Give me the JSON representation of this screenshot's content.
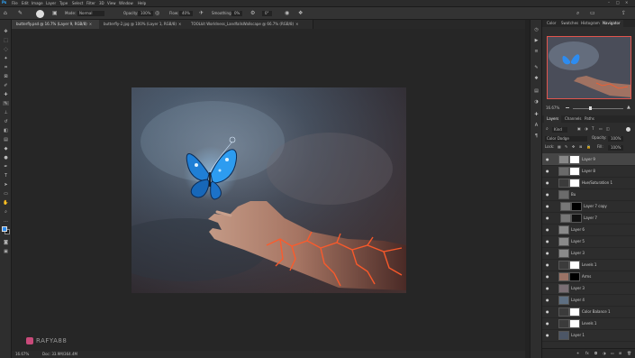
{
  "colors": {
    "accent": "#2d8cf0",
    "selection_red": "#e2554e"
  },
  "menubar": {
    "app_icon": "Ps",
    "items": [
      "File",
      "Edit",
      "Image",
      "Layer",
      "Type",
      "Select",
      "Filter",
      "3D",
      "View",
      "Window",
      "Help"
    ]
  },
  "options": {
    "mode_label": "Mode:",
    "mode_value": "Normal",
    "opacity_label": "Opacity:",
    "opacity_value": "100%",
    "flow_label": "Flow:",
    "flow_value": "40%",
    "smoothing_label": "Smoothing:",
    "smoothing_value": "0%",
    "angle_value": "0°"
  },
  "tabs": [
    {
      "label": "butterfly.psd @ 16.7% (Layer 9, RGB/8)",
      "close": "×"
    },
    {
      "label": "butterfly-2.jpg @ 100% (Layer 1, RGB/8)",
      "close": "×"
    },
    {
      "label": "TOOLkit Worldness_LandfallsWallscape @ 66.7% (RGB/8)",
      "close": "×"
    }
  ],
  "status": {
    "zoom": "16.67%",
    "doc": "Doc: 33.9M/364.4M"
  },
  "watermark": "RAFYA88",
  "navigator": {
    "tabs": [
      "Color",
      "Swatches",
      "Histogram",
      "Navigator"
    ],
    "zoom": "16.67%"
  },
  "layers_panel": {
    "tabs": [
      "Layers",
      "Channels",
      "Paths"
    ],
    "kind_label": "Kind",
    "blend_mode": "Color Dodge",
    "opacity_label": "Opacity:",
    "opacity_value": "100%",
    "lock_label": "Lock:",
    "fill_label": "Fill:",
    "fill_value": "100%",
    "layers": [
      "Layer 9",
      "Layer 8",
      "Hue/Saturation 1",
      "Bu",
      "Layer 7 copy",
      "Layer 7",
      "Layer 6",
      "Layer 5",
      "Layer 3",
      "Levels 1",
      "Arms",
      "Layer 3",
      "Layer 4",
      "Color Balance 1",
      "Levels 1",
      "Layer 1"
    ]
  }
}
